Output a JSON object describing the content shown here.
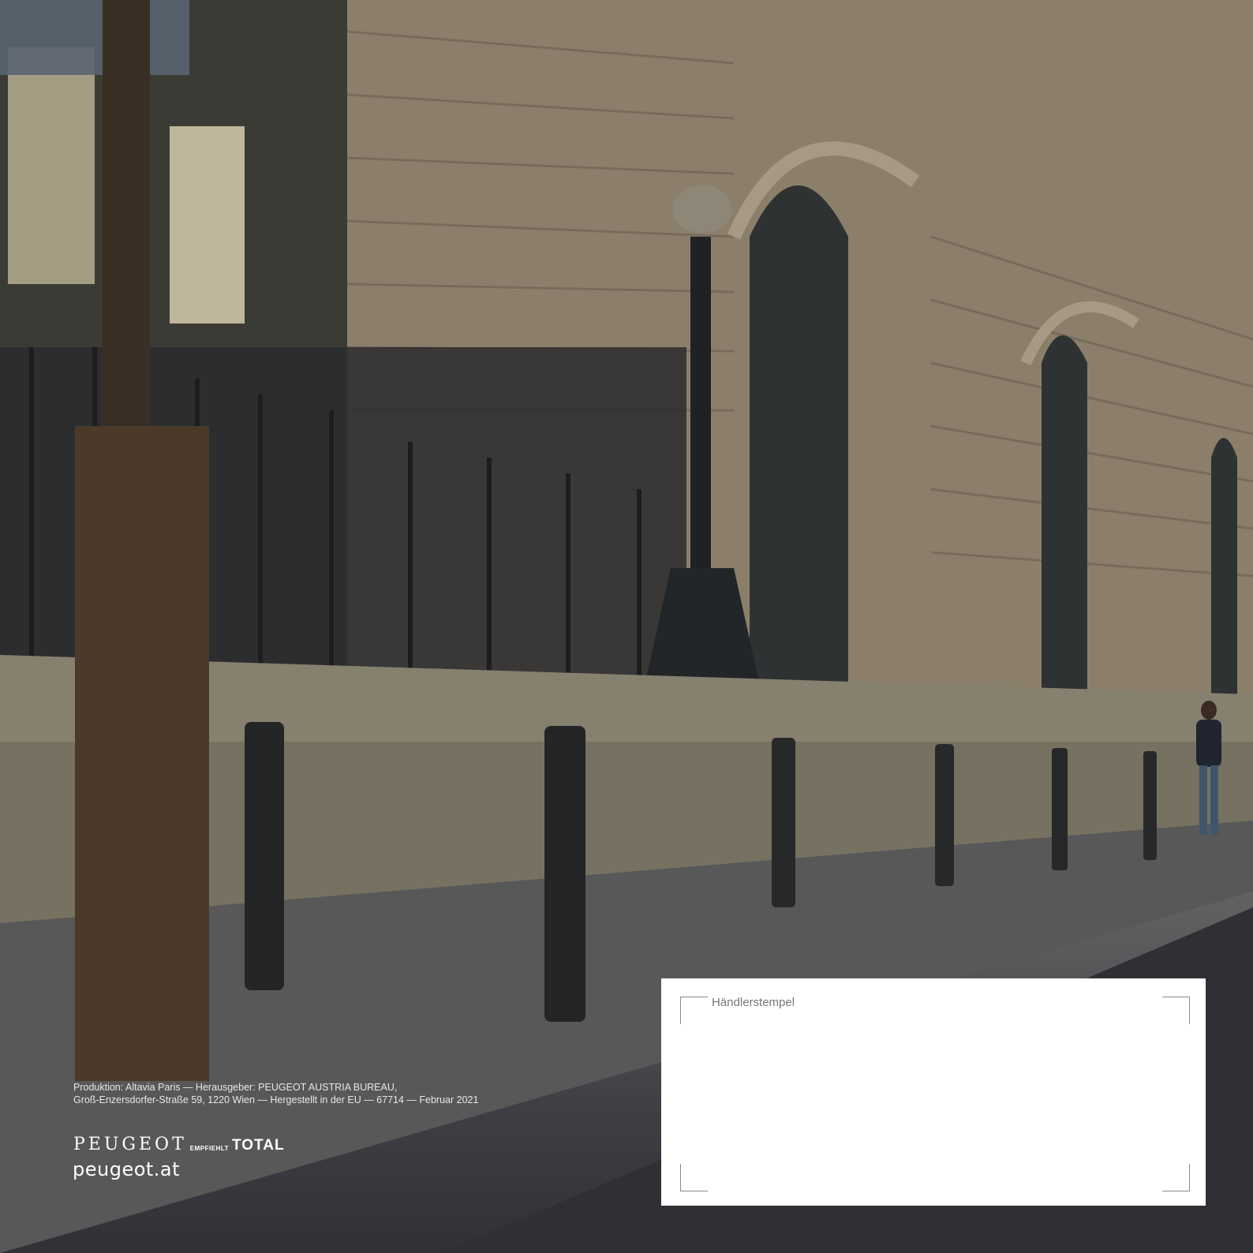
{
  "imprint": {
    "line1": "Produktion: Altavia Paris — Herausgeber: PEUGEOT AUSTRIA BUREAU,",
    "line2": "Groß-Enzersdorfer-Straße 59, 1220 Wien — Hergestellt in der EU — 67714 — Februar 2021"
  },
  "brand": {
    "name": "PEUGEOT",
    "recommends": "EMPFIEHLT",
    "partner": "TOTAL"
  },
  "website": "peugeot.at",
  "dealer_stamp": {
    "label": "Händlerstempel"
  }
}
